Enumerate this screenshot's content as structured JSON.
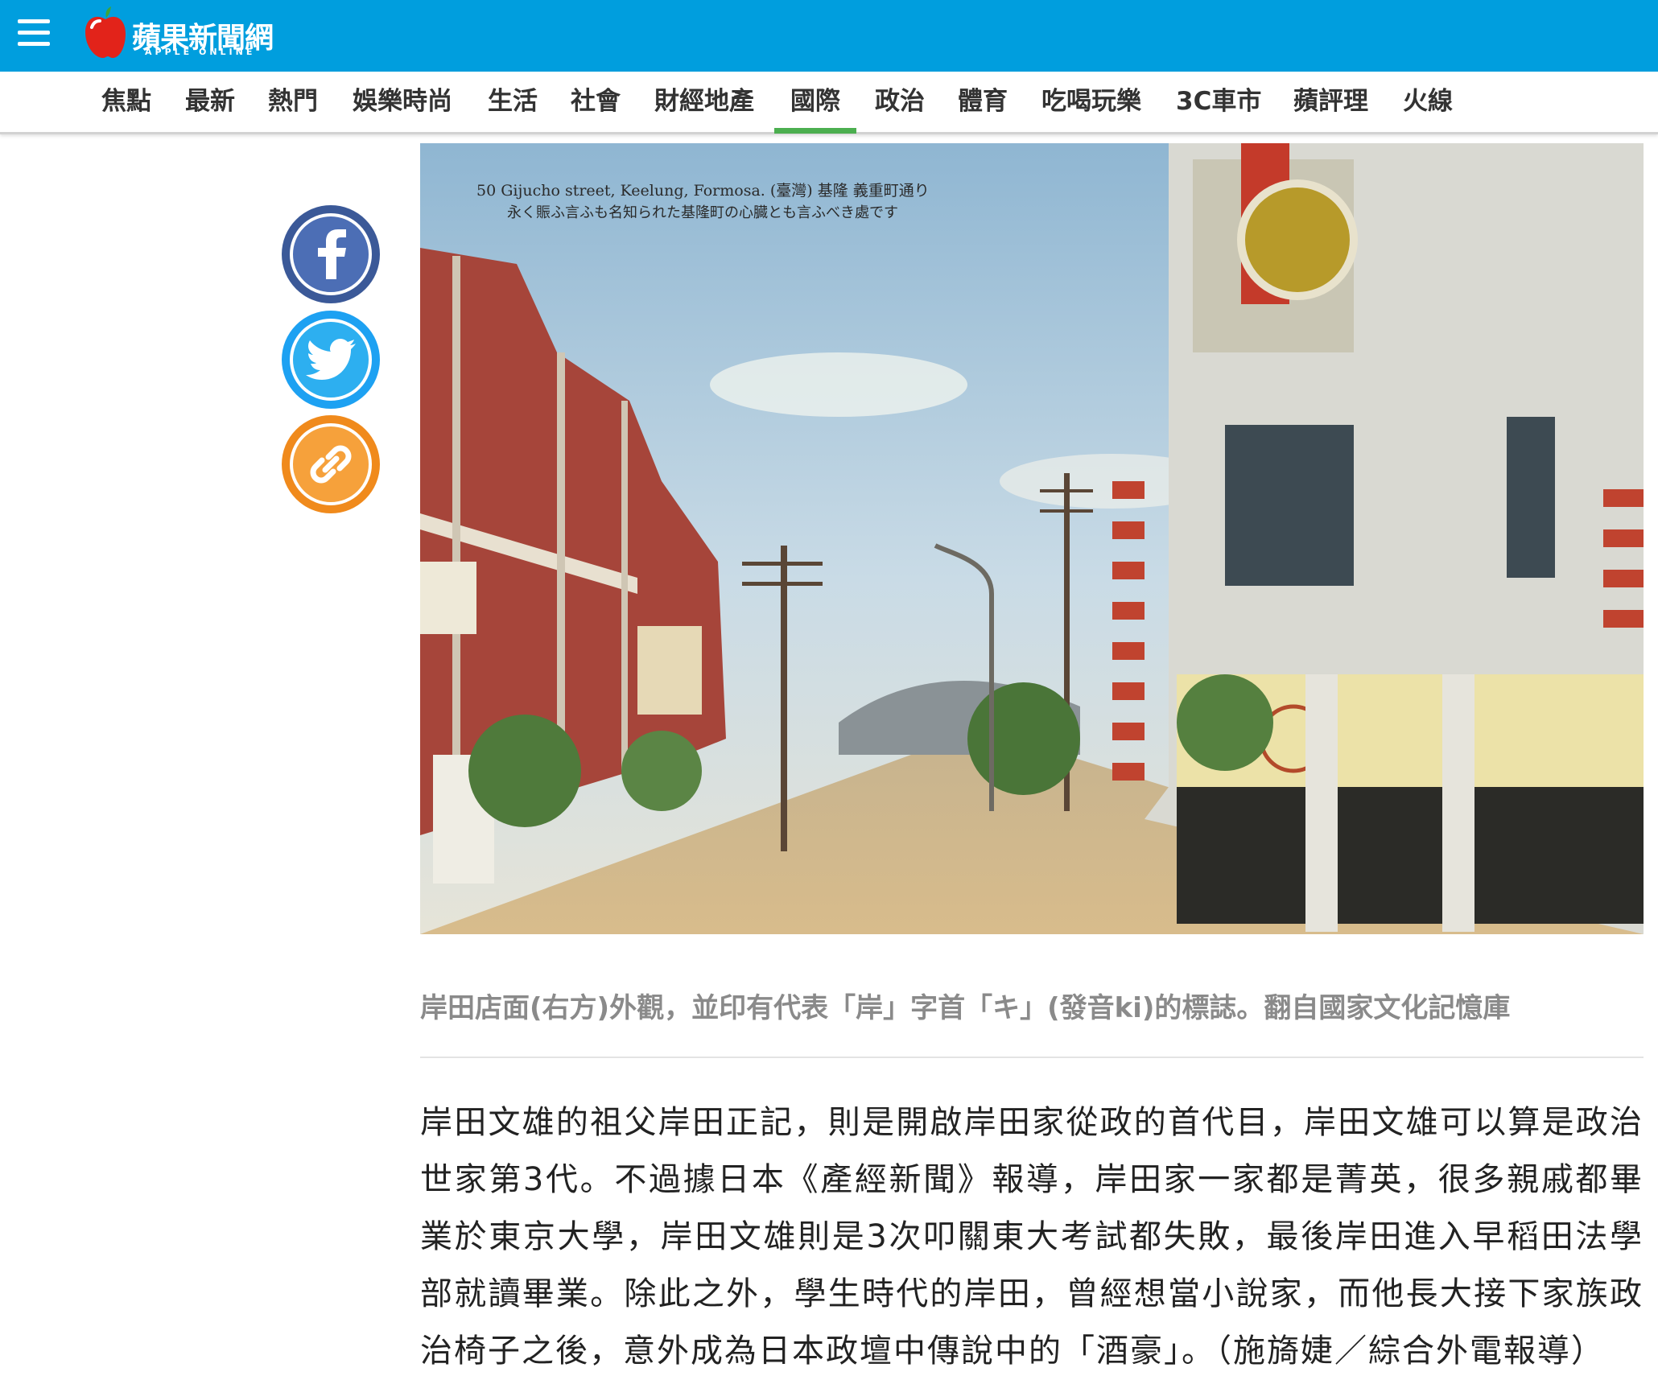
{
  "header": {
    "logo_title": "蘋果新聞網",
    "logo_sub": "APPLE ONLINE"
  },
  "nav": {
    "items": [
      {
        "label": "焦點"
      },
      {
        "label": "最新"
      },
      {
        "label": "熱門"
      },
      {
        "label": "娛樂時尚"
      },
      {
        "label": "生活"
      },
      {
        "label": "社會"
      },
      {
        "label": "財經地產"
      },
      {
        "label": "國際",
        "active": true
      },
      {
        "label": "政治"
      },
      {
        "label": "體育"
      },
      {
        "label": "吃喝玩樂"
      },
      {
        "label": "3C車市"
      },
      {
        "label": "蘋評理"
      },
      {
        "label": "火線"
      }
    ]
  },
  "share": {
    "facebook_icon": "facebook-icon",
    "twitter_icon": "twitter-icon",
    "link_icon": "link-icon"
  },
  "photo": {
    "postcard_line1": "50 Gijucho street, Keelung, Formosa.    (臺灣) 基隆 義重町通り",
    "postcard_line2": "永く賑ふ言ふも名知られた基隆町の心臓とも言ふべき處です"
  },
  "caption": "岸田店面(右方)外觀，並印有代表「岸」字首「キ」(發音ki)的標誌。翻自國家文化記憶庫",
  "article": {
    "paragraph": "岸田文雄的祖父岸田正記，則是開啟岸田家從政的首代目，岸田文雄可以算是政治世家第3代。不過據日本《產經新聞》報導，岸田家一家都是菁英，很多親戚都畢業於東京大學，岸田文雄則是3次叩關東大考試都失敗，最後岸田進入早稻田法學部就讀畢業。除此之外，學生時代的岸田，曾經想當小說家，而他長大接下家族政治椅子之後，意外成為日本政壇中傳說中的「酒豪」。（施旖婕／綜合外電報導）"
  },
  "colors": {
    "header_bg": "#009ede",
    "active_underline": "#4caf50",
    "facebook": "#3b5998",
    "twitter": "#1da1f2",
    "link": "#f08a1c"
  }
}
